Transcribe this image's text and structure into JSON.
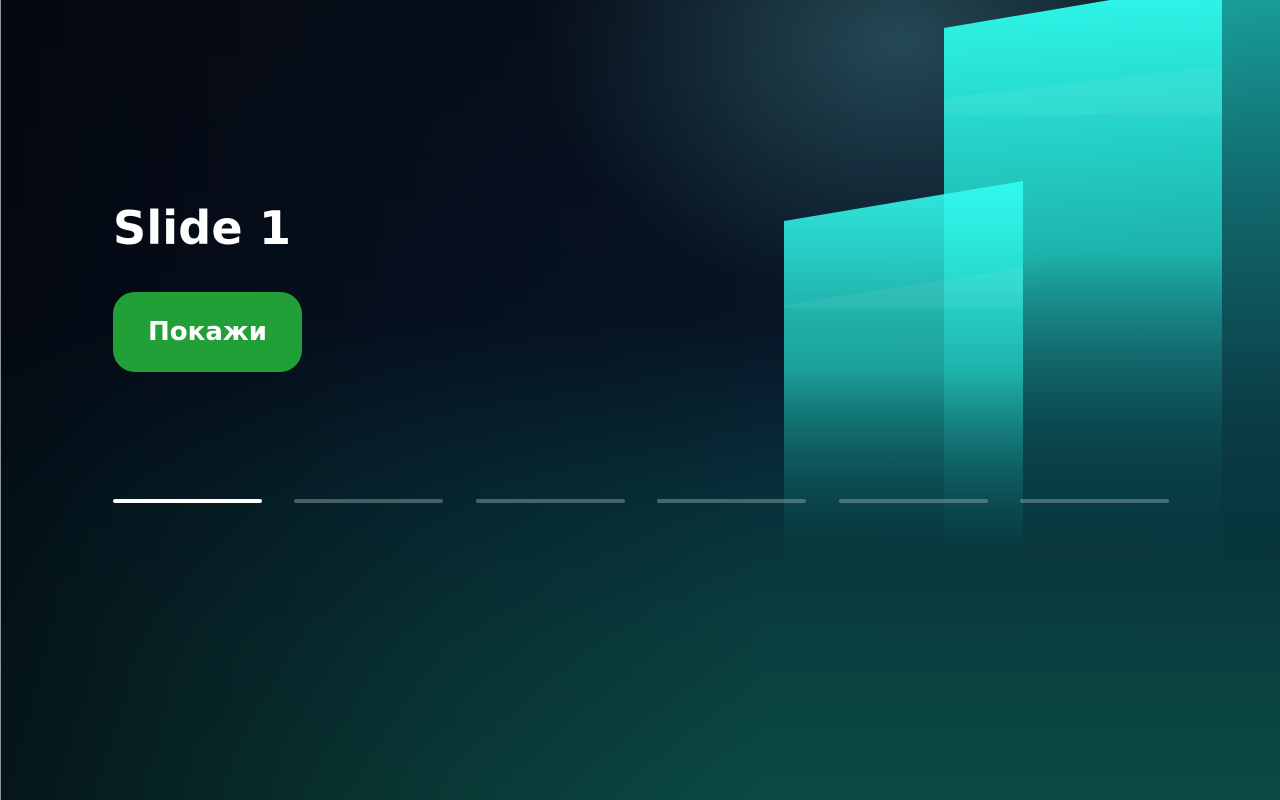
{
  "slide": {
    "title": "Slide 1",
    "button_label": "Покажи"
  },
  "progress": {
    "segments": [
      {
        "fill": 1.0
      },
      {
        "fill": 0.0
      },
      {
        "fill": 0.0
      },
      {
        "fill": 0.0
      },
      {
        "fill": 0.0
      },
      {
        "fill": 0.0
      }
    ]
  },
  "colors": {
    "accent": "#21a038",
    "glow": "#2efff0",
    "background": "#060b16"
  },
  "background_art": "glowing-cyan-panels"
}
